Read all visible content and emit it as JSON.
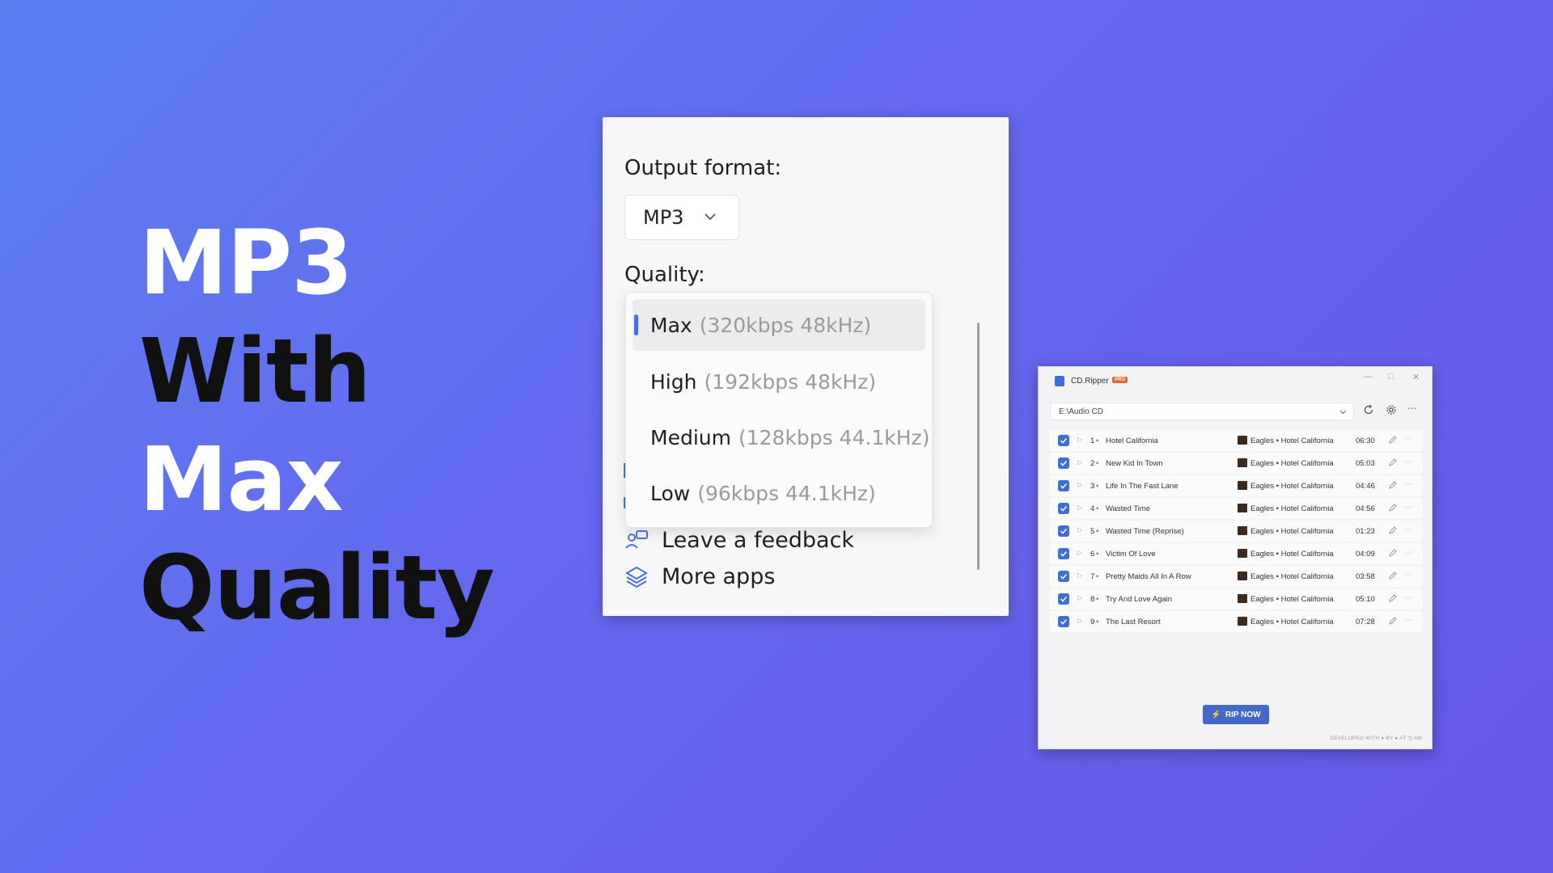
{
  "headline": {
    "line1": "MP3",
    "line2": "With",
    "line3": "Max",
    "line4": "Quality"
  },
  "settings": {
    "output_format_label": "Output format:",
    "format_selected": "MP3",
    "quality_label": "Quality:",
    "quality_options": [
      {
        "name": "Max",
        "detail": "(320kbps 48kHz)",
        "selected": true
      },
      {
        "name": "High",
        "detail": "(192kbps 48kHz)",
        "selected": false
      },
      {
        "name": "Medium",
        "detail": "(128kbps 44.1kHz)",
        "selected": false
      },
      {
        "name": "Low",
        "detail": "(96kbps 44.1kHz)",
        "selected": false
      }
    ],
    "links": [
      {
        "label": "Leave a feedback",
        "icon": "feedback-icon"
      },
      {
        "label": "More apps",
        "icon": "layers-icon"
      }
    ]
  },
  "app": {
    "title": "CD.Ripper",
    "badge": "PRO",
    "drive": "E:\\Audio CD",
    "tracks": [
      {
        "num": "1",
        "title": "Hotel California",
        "artist_album": "Eagles • Hotel California",
        "duration": "06:30"
      },
      {
        "num": "2",
        "title": "New Kid In Town",
        "artist_album": "Eagles • Hotel California",
        "duration": "05:03"
      },
      {
        "num": "3",
        "title": "Life In The Fast Lane",
        "artist_album": "Eagles • Hotel California",
        "duration": "04:46"
      },
      {
        "num": "4",
        "title": "Wasted Time",
        "artist_album": "Eagles • Hotel California",
        "duration": "04:56"
      },
      {
        "num": "5",
        "title": "Wasted Time (Reprise)",
        "artist_album": "Eagles • Hotel California",
        "duration": "01:23"
      },
      {
        "num": "6",
        "title": "Victim Of Love",
        "artist_album": "Eagles • Hotel California",
        "duration": "04:09"
      },
      {
        "num": "7",
        "title": "Pretty Maids All In A Row",
        "artist_album": "Eagles • Hotel California",
        "duration": "03:58"
      },
      {
        "num": "8",
        "title": "Try And Love Again",
        "artist_album": "Eagles • Hotel California",
        "duration": "05:10"
      },
      {
        "num": "9",
        "title": "The Last Resort",
        "artist_album": "Eagles • Hotel California",
        "duration": "07:28"
      }
    ],
    "rip_button": "RIP NOW",
    "footer": "DEVELOPED WITH ● BY ● AT ◷ AM",
    "accent_color": "#3f6fd6",
    "badge_color": "#e2672e"
  }
}
